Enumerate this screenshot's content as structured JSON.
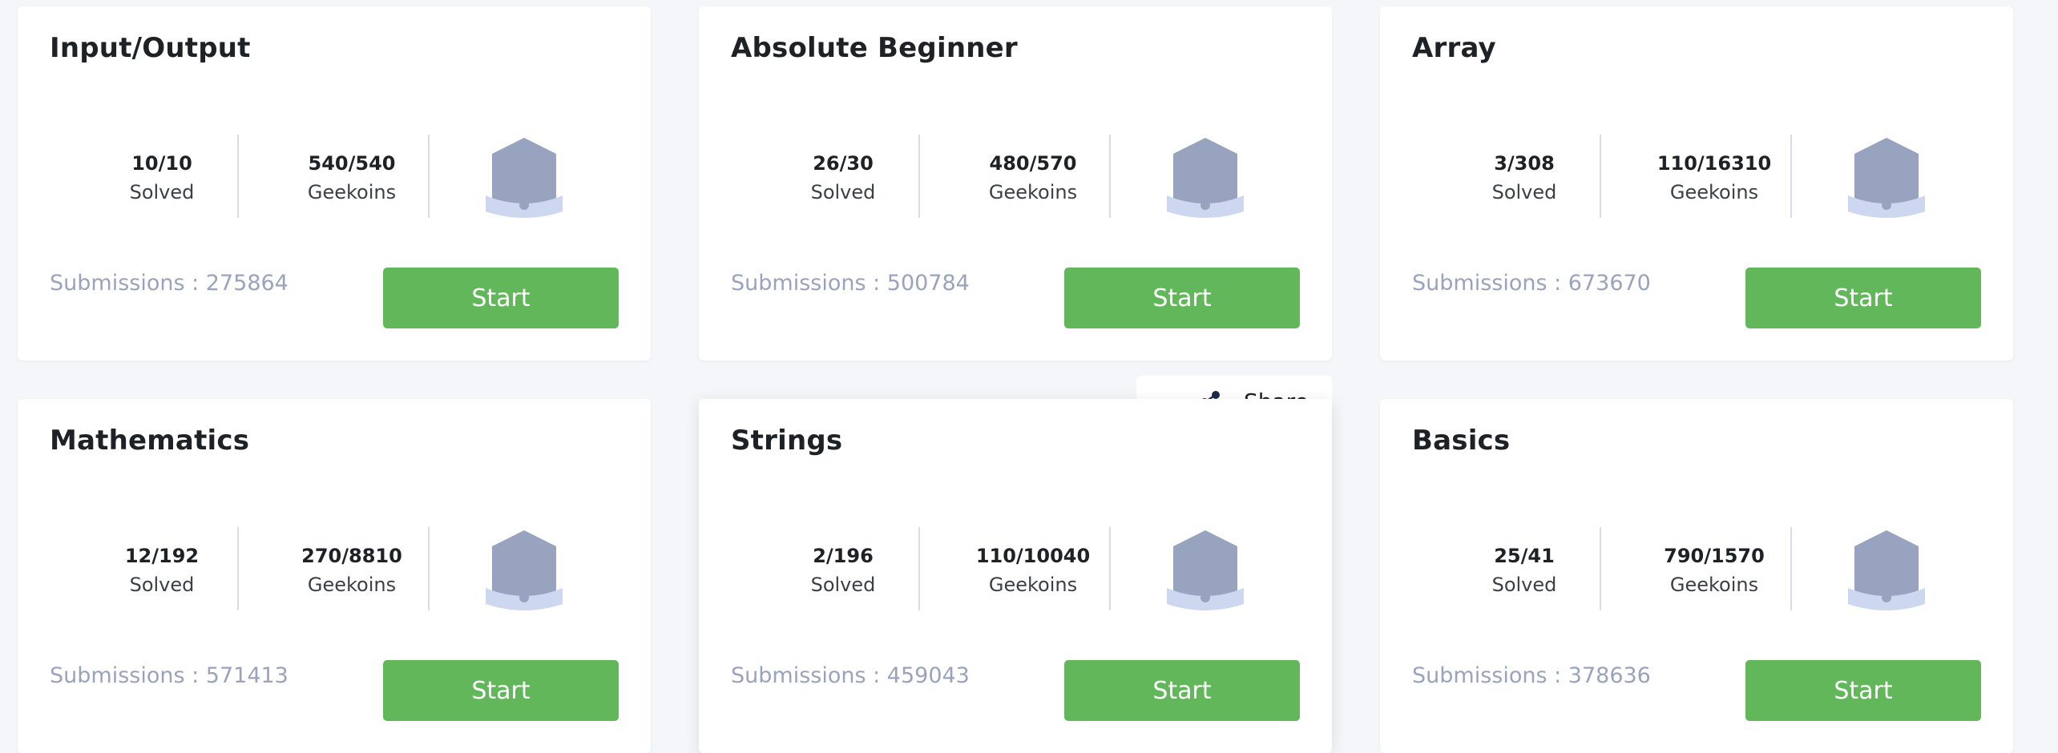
{
  "cards": [
    {
      "title": "Input/Output",
      "solved": "10/10",
      "solved_label": "Solved",
      "geekoins": "540/540",
      "geekoins_label": "Geekoins",
      "submissions": "Submissions : 275864",
      "start_label": "Start"
    },
    {
      "title": "Absolute Beginner",
      "solved": "26/30",
      "solved_label": "Solved",
      "geekoins": "480/570",
      "geekoins_label": "Geekoins",
      "submissions": "Submissions : 500784",
      "start_label": "Start"
    },
    {
      "title": "Array",
      "solved": "3/308",
      "solved_label": "Solved",
      "geekoins": "110/16310",
      "geekoins_label": "Geekoins",
      "submissions": "Submissions : 673670",
      "start_label": "Start"
    },
    {
      "title": "Mathematics",
      "solved": "12/192",
      "solved_label": "Solved",
      "geekoins": "270/8810",
      "geekoins_label": "Geekoins",
      "submissions": "Submissions : 571413",
      "start_label": "Start"
    },
    {
      "title": "Strings",
      "solved": "2/196",
      "solved_label": "Solved",
      "geekoins": "110/10040",
      "geekoins_label": "Geekoins",
      "submissions": "Submissions : 459043",
      "start_label": "Start"
    },
    {
      "title": "Basics",
      "solved": "25/41",
      "solved_label": "Solved",
      "geekoins": "790/1570",
      "geekoins_label": "Geekoins",
      "submissions": "Submissions : 378636",
      "start_label": "Start"
    }
  ],
  "share": {
    "label": "Share",
    "icon": "share-icon"
  },
  "icons": {
    "badge": "badge-icon"
  },
  "colors": {
    "start_button": "#61b75a",
    "badge_body": "#98a4bf",
    "badge_ribbon": "#cdd7f0",
    "submissions_text": "#9aa3bd"
  }
}
